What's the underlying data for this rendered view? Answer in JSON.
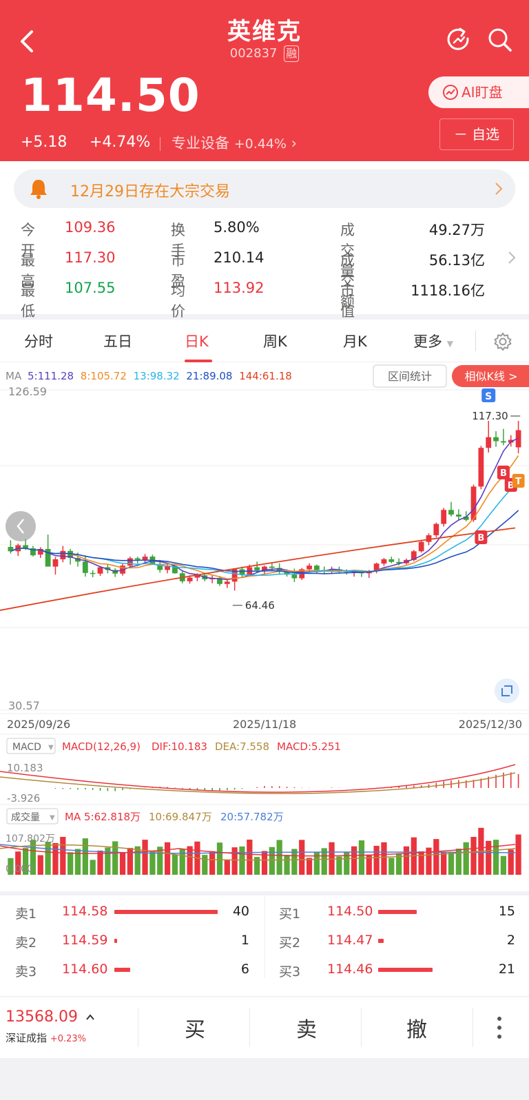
{
  "header": {
    "stock_name": "英维克",
    "stock_code": "002837",
    "margin_tag": "融",
    "price": "114.50",
    "change": "+5.18",
    "change_pct": "+4.74%",
    "industry": "专业设备",
    "industry_pct": "+0.44%",
    "ai_button": "AI盯盘",
    "watch_button": "－ 自选"
  },
  "notice": {
    "text": "12月29日存在大宗交易"
  },
  "quote": [
    {
      "label": "今开",
      "value": "109.36",
      "color": "red"
    },
    {
      "label": "换手",
      "value": "5.80%",
      "color": "black"
    },
    {
      "label": "成交量",
      "value": "49.27万",
      "color": "black"
    },
    {
      "label": "最高",
      "value": "117.30",
      "color": "red"
    },
    {
      "label": "市盈",
      "value": "210.14",
      "color": "black"
    },
    {
      "label": "成交额",
      "value": "56.13亿",
      "color": "black"
    },
    {
      "label": "最低",
      "value": "107.55",
      "color": "green"
    },
    {
      "label": "均价",
      "value": "113.92",
      "color": "red"
    },
    {
      "label": "市　值",
      "value": "1118.16亿",
      "color": "black"
    }
  ],
  "tabs": [
    "分时",
    "五日",
    "日K",
    "周K",
    "月K",
    "更多"
  ],
  "active_tab": "日K",
  "chart_data": {
    "type": "candlestick",
    "ma_legend": {
      "prefix": "MA",
      "items": [
        {
          "text": "5:111.28",
          "color": "#5a3fc0"
        },
        {
          "text": "8:105.72",
          "color": "#f08a24"
        },
        {
          "text": "13:98.32",
          "color": "#2ab4e8"
        },
        {
          "text": "21:89.08",
          "color": "#1f4fbf"
        },
        {
          "text": "144:61.18",
          "color": "#e04020"
        }
      ]
    },
    "range_button": "区间统计",
    "similar_button": "相似K线 >",
    "y_max_label": "126.59",
    "y_min_label": "30.57",
    "ylim": [
      30.57,
      126.59
    ],
    "high_marker": "117.30",
    "low_marker": "64.46",
    "dates": [
      "2025/09/26",
      "2025/11/18",
      "2025/12/30"
    ],
    "candles": [
      [
        79.5,
        81.5,
        77.5,
        78.2
      ],
      [
        78.2,
        80.5,
        76.8,
        80.0
      ],
      [
        80.0,
        81.8,
        78.6,
        79.1
      ],
      [
        79.1,
        79.8,
        76.6,
        77.0
      ],
      [
        77.2,
        79.4,
        76.2,
        78.9
      ],
      [
        78.9,
        83.2,
        75.0,
        73.6
      ],
      [
        73.6,
        76.5,
        71.2,
        75.8
      ],
      [
        75.8,
        79.8,
        74.9,
        78.3
      ],
      [
        78.3,
        78.9,
        74.2,
        76.2
      ],
      [
        76.2,
        77.8,
        73.6,
        75.1
      ],
      [
        75.1,
        77.0,
        70.6,
        71.7
      ],
      [
        71.7,
        72.5,
        70.4,
        71.5
      ],
      [
        71.5,
        73.8,
        70.8,
        73.4
      ],
      [
        73.4,
        74.2,
        71.6,
        72.6
      ],
      [
        72.6,
        73.1,
        70.5,
        71.5
      ],
      [
        71.5,
        74.7,
        70.9,
        73.9
      ],
      [
        73.9,
        76.6,
        73.1,
        76.1
      ],
      [
        76.1,
        76.6,
        74.5,
        75.7
      ],
      [
        75.7,
        77.4,
        74.8,
        76.6
      ],
      [
        76.6,
        77.2,
        74.2,
        74.4
      ],
      [
        74.4,
        75.6,
        71.8,
        72.6
      ],
      [
        72.6,
        74.5,
        71.6,
        73.9
      ],
      [
        73.9,
        74.2,
        71.5,
        71.6
      ],
      [
        71.6,
        72.2,
        68.6,
        69.2
      ],
      [
        69.2,
        71.0,
        68.5,
        70.3
      ],
      [
        70.3,
        71.6,
        69.2,
        71.0
      ],
      [
        71.0,
        71.6,
        69.2,
        69.8
      ],
      [
        69.8,
        70.9,
        68.6,
        70.2
      ],
      [
        70.2,
        70.8,
        67.8,
        68.4
      ],
      [
        68.4,
        69.8,
        67.2,
        69.1
      ],
      [
        69.1,
        73.0,
        66.4,
        72.8
      ],
      [
        72.8,
        73.6,
        70.2,
        71.2
      ],
      [
        71.2,
        74.2,
        70.8,
        73.4
      ],
      [
        73.4,
        75.1,
        71.8,
        72.5
      ],
      [
        72.5,
        73.9,
        71.2,
        73.6
      ],
      [
        73.6,
        74.8,
        72.2,
        73.2
      ],
      [
        73.2,
        74.6,
        71.2,
        72.1
      ],
      [
        72.1,
        72.8,
        70.6,
        71.2
      ],
      [
        71.2,
        73.0,
        69.0,
        70.1
      ],
      [
        70.1,
        73.2,
        69.6,
        72.8
      ],
      [
        72.8,
        74.6,
        71.8,
        73.9
      ],
      [
        73.9,
        74.2,
        71.6,
        72.6
      ],
      [
        72.6,
        73.6,
        71.5,
        72.1
      ],
      [
        72.1,
        73.6,
        71.6,
        72.8
      ],
      [
        72.8,
        73.6,
        71.5,
        72.0
      ],
      [
        72.0,
        72.8,
        71.2,
        71.8
      ],
      [
        71.8,
        72.4,
        70.6,
        72.2
      ],
      [
        72.2,
        72.6,
        70.5,
        71.6
      ],
      [
        71.6,
        72.6,
        70.2,
        72.3
      ],
      [
        72.3,
        74.8,
        71.6,
        74.5
      ],
      [
        74.5,
        76.2,
        73.8,
        75.8
      ],
      [
        75.8,
        76.6,
        74.6,
        75.0
      ],
      [
        75.0,
        76.1,
        74.0,
        74.6
      ],
      [
        74.6,
        76.0,
        74.2,
        75.6
      ],
      [
        75.6,
        78.6,
        75.2,
        78.2
      ],
      [
        78.2,
        81.6,
        77.8,
        81.0
      ],
      [
        81.0,
        83.6,
        80.0,
        83.0
      ],
      [
        83.0,
        86.8,
        82.4,
        86.4
      ],
      [
        86.4,
        91.2,
        85.6,
        90.6
      ],
      [
        90.6,
        93.0,
        88.6,
        89.2
      ],
      [
        89.2,
        90.8,
        87.6,
        88.6
      ],
      [
        88.6,
        90.2,
        87.2,
        87.6
      ],
      [
        87.6,
        98.2,
        87.0,
        97.6
      ],
      [
        97.6,
        109.8,
        96.8,
        109.2
      ],
      [
        109.2,
        117.3,
        107.8,
        112.4
      ],
      [
        112.4,
        114.2,
        109.5,
        111.2
      ],
      [
        111.2,
        114.9,
        110.0,
        110.8
      ],
      [
        110.8,
        113.0,
        109.6,
        111.6
      ],
      [
        109.36,
        117.3,
        107.55,
        114.5
      ]
    ],
    "ma144": {
      "start": 57.5,
      "end": 61.18
    }
  },
  "macd": {
    "dropdown": "MACD",
    "params": "MACD(12,26,9)",
    "dif": "DIF:10.183",
    "dea": "DEA:7.558",
    "macd": "MACD:5.251",
    "top_label": "10.183",
    "bottom_label": "-3.926"
  },
  "volume": {
    "dropdown": "成交量",
    "ma5": "MA 5:62.818万",
    "ma10": "10:69.847万",
    "ma20": "20:57.782万",
    "top_label": "107.802万",
    "bottom_label": "0.000"
  },
  "orders": {
    "sell": [
      {
        "label": "卖1",
        "price": "114.58",
        "qty": "40",
        "bar": 1.0
      },
      {
        "label": "卖2",
        "price": "114.59",
        "qty": "1",
        "bar": 0.025
      },
      {
        "label": "卖3",
        "price": "114.60",
        "qty": "6",
        "bar": 0.15
      }
    ],
    "buy": [
      {
        "label": "买1",
        "price": "114.50",
        "qty": "15",
        "bar": 0.375
      },
      {
        "label": "买2",
        "price": "114.47",
        "qty": "2",
        "bar": 0.05
      },
      {
        "label": "买3",
        "price": "114.46",
        "qty": "21",
        "bar": 0.525
      }
    ]
  },
  "bottom_bar": {
    "index_value": "13568.09",
    "index_name": "深证成指",
    "index_pct": "+0.23%",
    "buy": "买",
    "sell": "卖",
    "cancel": "撤"
  }
}
